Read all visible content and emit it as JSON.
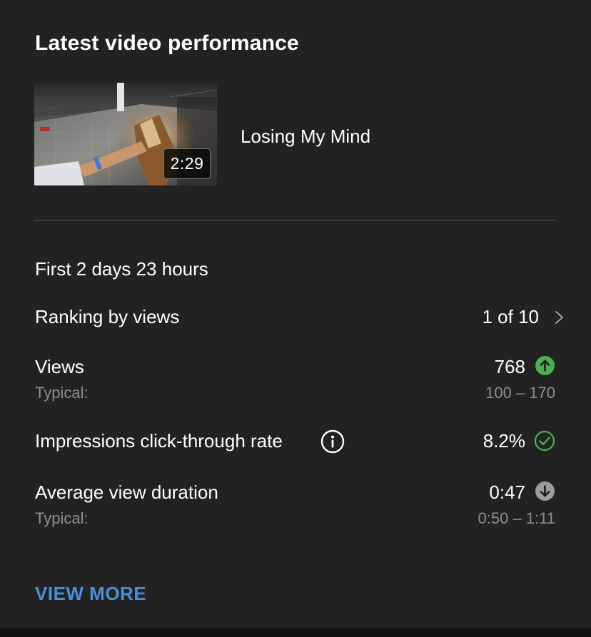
{
  "card": {
    "title": "Latest video performance",
    "video": {
      "title": "Losing My Mind",
      "duration": "2:29"
    },
    "period": "First 2 days 23 hours",
    "ranking": {
      "label": "Ranking by views",
      "value": "1 of 10",
      "icon": "chevron-right-icon"
    },
    "views": {
      "label": "Views",
      "value": "768",
      "status_icon": "arrow-up-circle-icon",
      "status_color": "#4caf50",
      "typical_label": "Typical:",
      "typical_range": "100 – 170"
    },
    "ctr": {
      "label": "Impressions click-through rate",
      "info_icon": "info-icon",
      "value": "8.2%",
      "status_icon": "check-circle-icon",
      "status_color": "#4caf50"
    },
    "avg_duration": {
      "label": "Average view duration",
      "value": "0:47",
      "status_icon": "arrow-down-circle-icon",
      "status_color": "#9e9e9e",
      "typical_label": "Typical:",
      "typical_range": "0:50 – 1:11"
    },
    "view_more": "VIEW MORE"
  },
  "colors": {
    "background": "#111111",
    "card": "#222222",
    "text_primary": "#ffffff",
    "text_secondary": "#8e8e8e",
    "accent_link": "#4a90d9",
    "positive": "#4caf50"
  }
}
